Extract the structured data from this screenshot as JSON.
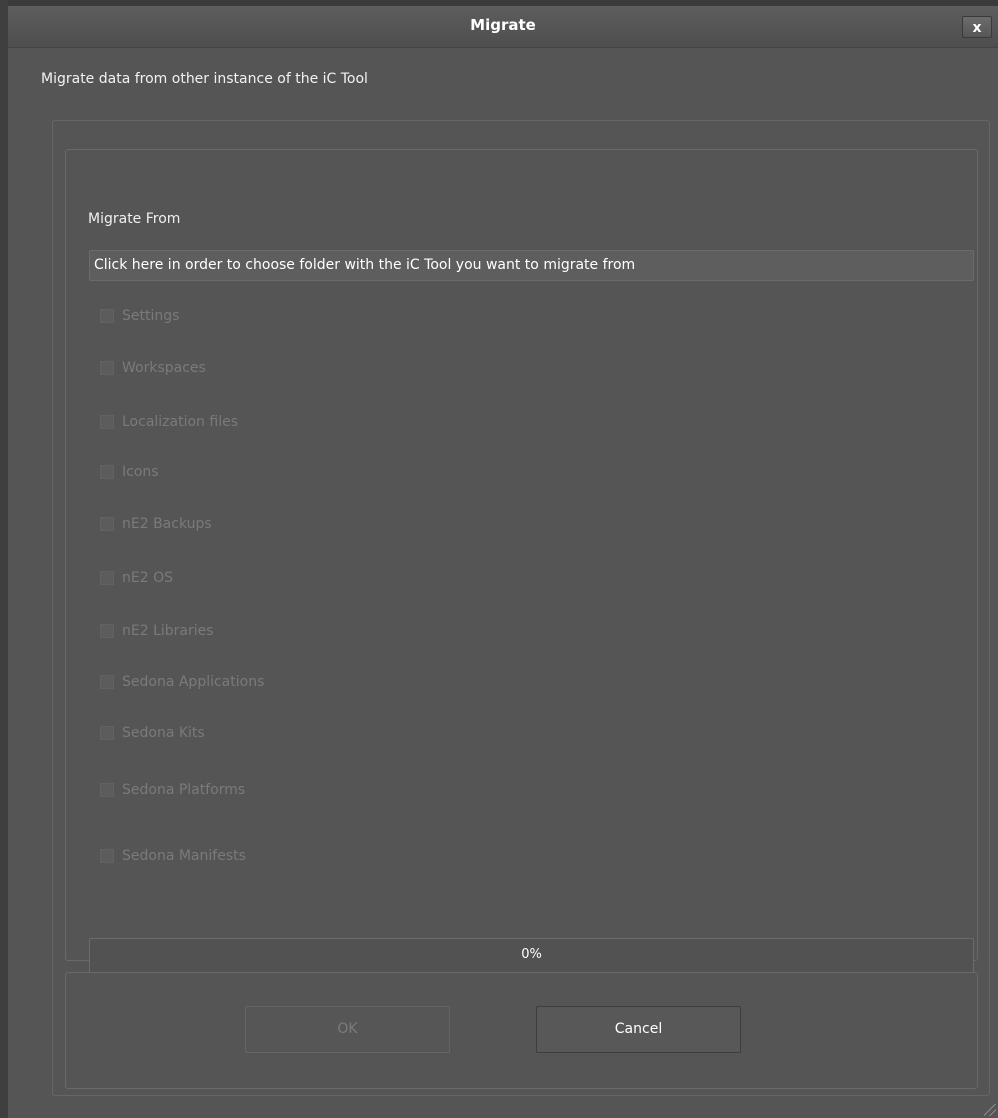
{
  "window": {
    "title": "Migrate",
    "close_label": "x"
  },
  "description": "Migrate data from other instance of the iC Tool",
  "migrate_from": {
    "label": "Migrate From",
    "field_value": "Click here in order to choose folder with the iC Tool you want to migrate from"
  },
  "options": [
    {
      "label": "Settings",
      "checked": false,
      "enabled": false
    },
    {
      "label": "Workspaces",
      "checked": false,
      "enabled": false
    },
    {
      "label": "Localization files",
      "checked": false,
      "enabled": false
    },
    {
      "label": "Icons",
      "checked": false,
      "enabled": false
    },
    {
      "label": "nE2 Backups",
      "checked": false,
      "enabled": false
    },
    {
      "label": "nE2 OS",
      "checked": false,
      "enabled": false
    },
    {
      "label": "nE2 Libraries",
      "checked": false,
      "enabled": false
    },
    {
      "label": "Sedona Applications",
      "checked": false,
      "enabled": false
    },
    {
      "label": "Sedona Kits",
      "checked": false,
      "enabled": false
    },
    {
      "label": "Sedona Platforms",
      "checked": false,
      "enabled": false
    },
    {
      "label": "Sedona Manifests",
      "checked": false,
      "enabled": false
    }
  ],
  "progress": {
    "value": 0,
    "text": "0%"
  },
  "buttons": {
    "ok_label": "OK",
    "ok_enabled": false,
    "cancel_label": "Cancel"
  },
  "colors": {
    "background": "#555555",
    "text": "#f0f0f0",
    "disabled_text": "#7a7a7a"
  }
}
